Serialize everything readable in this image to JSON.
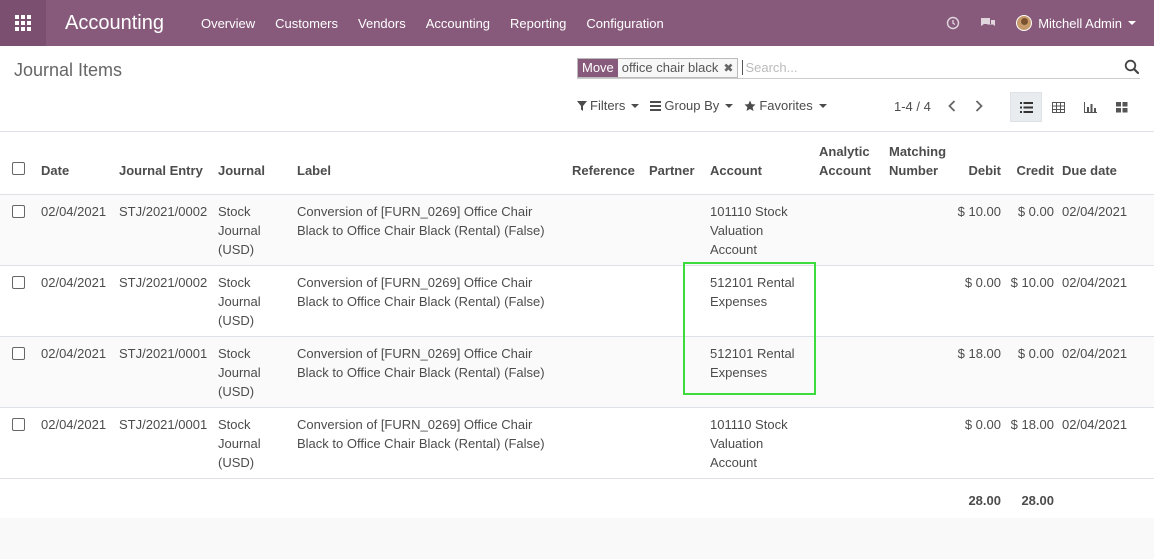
{
  "navbar": {
    "app_name": "Accounting",
    "menu": [
      "Overview",
      "Customers",
      "Vendors",
      "Accounting",
      "Reporting",
      "Configuration"
    ],
    "user_name": "Mitchell Admin",
    "color": "#875a7b"
  },
  "control_panel": {
    "title": "Journal Items",
    "search": {
      "facet_label": "Move",
      "facet_value": "office chair black",
      "placeholder": "Search..."
    },
    "filters_label": "Filters",
    "groupby_label": "Group By",
    "favorites_label": "Favorites",
    "pager": "1-4 / 4"
  },
  "table": {
    "headers": {
      "date": "Date",
      "journal_entry": "Journal Entry",
      "journal": "Journal",
      "label": "Label",
      "reference": "Reference",
      "partner": "Partner",
      "account": "Account",
      "analytic_account": "Analytic Account",
      "matching_number": "Matching Number",
      "debit": "Debit",
      "credit": "Credit",
      "due_date": "Due date"
    },
    "rows": [
      {
        "date": "02/04/2021",
        "entry": "STJ/2021/0002",
        "journal": "Stock Journal (USD)",
        "label": "Conversion of [FURN_0269] Office Chair Black to Office Chair Black (Rental) (False)",
        "reference": "",
        "partner": "",
        "account": "101110 Stock Valuation Account",
        "analytic": "",
        "matching": "",
        "debit": "$ 10.00",
        "credit": "$ 0.00",
        "due": "02/04/2021"
      },
      {
        "date": "02/04/2021",
        "entry": "STJ/2021/0002",
        "journal": "Stock Journal (USD)",
        "label": "Conversion of [FURN_0269] Office Chair Black to Office Chair Black (Rental) (False)",
        "reference": "",
        "partner": "",
        "account": "512101 Rental Expenses",
        "analytic": "",
        "matching": "",
        "debit": "$ 0.00",
        "credit": "$ 10.00",
        "due": "02/04/2021"
      },
      {
        "date": "02/04/2021",
        "entry": "STJ/2021/0001",
        "journal": "Stock Journal (USD)",
        "label": "Conversion of [FURN_0269] Office Chair Black to Office Chair Black (Rental) (False)",
        "reference": "",
        "partner": "",
        "account": "512101 Rental Expenses",
        "analytic": "",
        "matching": "",
        "debit": "$ 18.00",
        "credit": "$ 0.00",
        "due": "02/04/2021"
      },
      {
        "date": "02/04/2021",
        "entry": "STJ/2021/0001",
        "journal": "Stock Journal (USD)",
        "label": "Conversion of [FURN_0269] Office Chair Black to Office Chair Black (Rental) (False)",
        "reference": "",
        "partner": "",
        "account": "101110 Stock Valuation Account",
        "analytic": "",
        "matching": "",
        "debit": "$ 0.00",
        "credit": "$ 18.00",
        "due": "02/04/2021"
      }
    ],
    "totals": {
      "debit": "28.00",
      "credit": "28.00"
    }
  },
  "highlight_color": "#3ddc3d"
}
